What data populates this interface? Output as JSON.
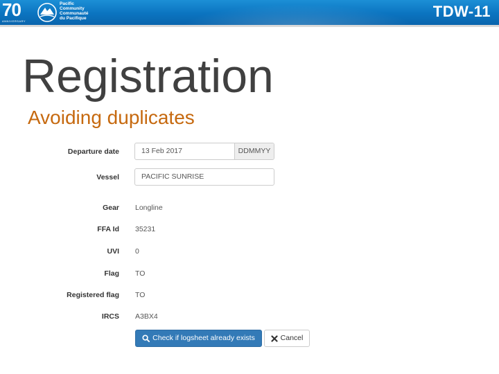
{
  "banner": {
    "anniversary_number": "70",
    "anniversary_caption": "ANNIVERSARY",
    "org_lines": [
      "Pacific",
      "Community",
      "Communauté",
      "du Pacifique"
    ],
    "event_title": "TDW-11"
  },
  "slide": {
    "title": "Registration",
    "subtitle": "Avoiding duplicates"
  },
  "form": {
    "departure_date": {
      "label": "Departure date",
      "value": "13 Feb 2017",
      "addon": "DDMMYY"
    },
    "vessel": {
      "label": "Vessel",
      "value": "PACIFIC SUNRISE"
    },
    "gear": {
      "label": "Gear",
      "value": "Longline"
    },
    "ffa_id": {
      "label": "FFA Id",
      "value": "35231"
    },
    "uvi": {
      "label": "UVI",
      "value": "0"
    },
    "flag": {
      "label": "Flag",
      "value": "TO"
    },
    "registered_flag": {
      "label": "Registered flag",
      "value": "TO"
    },
    "ircs": {
      "label": "IRCS",
      "value": "A3BX4"
    },
    "check_button": {
      "label": "Check if logsheet already exists",
      "icon": "search-icon"
    },
    "cancel_button": {
      "label": "Cancel",
      "icon": "close-icon"
    }
  },
  "colors": {
    "banner_blue": "#0b74c0",
    "subtitle_orange": "#c6690f",
    "primary_button": "#337ab7"
  }
}
